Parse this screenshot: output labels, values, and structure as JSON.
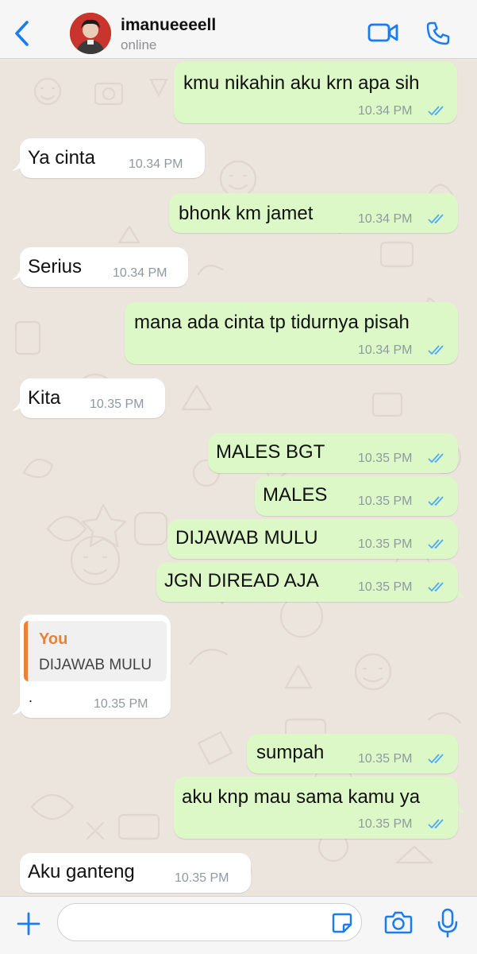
{
  "header": {
    "contact_name": "imanueeeell",
    "status": "online"
  },
  "messages": [
    {
      "dir": "out",
      "text": "kmu nikahin aku krn apa sih",
      "time": "10.34 PM",
      "read": true
    },
    {
      "dir": "in",
      "text": "Ya cinta",
      "time": "10.34 PM"
    },
    {
      "dir": "out",
      "text": "bhonk km jamet",
      "time": "10.34 PM",
      "read": true
    },
    {
      "dir": "in",
      "text": "Serius",
      "time": "10.34 PM"
    },
    {
      "dir": "out",
      "text": "mana ada cinta tp tidurnya pisah",
      "time": "10.34 PM",
      "read": true
    },
    {
      "dir": "in",
      "text": "Kita",
      "time": "10.35 PM"
    },
    {
      "dir": "out",
      "text": "MALES BGT",
      "time": "10.35 PM",
      "read": true
    },
    {
      "dir": "out",
      "text": "MALES",
      "time": "10.35 PM",
      "read": true
    },
    {
      "dir": "out",
      "text": "DIJAWAB MULU",
      "time": "10.35 PM",
      "read": true
    },
    {
      "dir": "out",
      "text": "JGN DIREAD AJA",
      "time": "10.35 PM",
      "read": true
    },
    {
      "dir": "in",
      "text": ".",
      "time": "10.35 PM",
      "quote_author": "You",
      "quote_text": "DIJAWAB MULU"
    },
    {
      "dir": "out",
      "text": "sumpah",
      "time": "10.35 PM",
      "read": true
    },
    {
      "dir": "out",
      "text": "aku knp mau sama kamu ya",
      "time": "10.35 PM",
      "read": true
    },
    {
      "dir": "in",
      "text": "Aku ganteng",
      "time": "10.35 PM"
    }
  ],
  "colors": {
    "accent": "#1a7cf5",
    "outgoing_bubble": "#dcf8c6",
    "incoming_bubble": "#ffffff",
    "chat_background": "#ece5dd",
    "read_ticks": "#4fa9f7",
    "quote_author": "#e8823b"
  },
  "icons": {
    "back": "chevron-left-icon",
    "video_call": "video-camera-icon",
    "voice_call": "phone-icon",
    "attach": "plus-icon",
    "sticker": "sticker-icon",
    "camera": "camera-icon",
    "microphone": "microphone-icon"
  }
}
